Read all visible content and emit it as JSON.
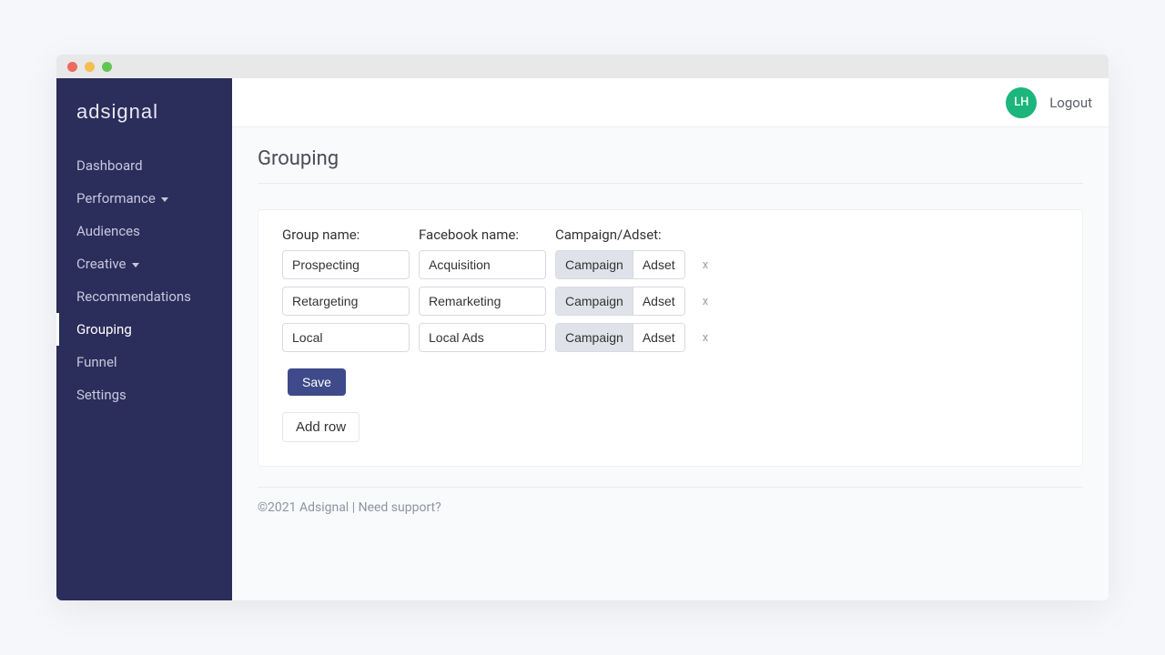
{
  "brand": "adsignal",
  "sidebar": {
    "items": [
      {
        "label": "Dashboard",
        "hasCaret": false,
        "active": false
      },
      {
        "label": "Performance",
        "hasCaret": true,
        "active": false
      },
      {
        "label": "Audiences",
        "hasCaret": false,
        "active": false
      },
      {
        "label": "Creative",
        "hasCaret": true,
        "active": false
      },
      {
        "label": "Recommendations",
        "hasCaret": false,
        "active": false
      },
      {
        "label": "Grouping",
        "hasCaret": false,
        "active": true
      },
      {
        "label": "Funnel",
        "hasCaret": false,
        "active": false
      },
      {
        "label": "Settings",
        "hasCaret": false,
        "active": false
      }
    ]
  },
  "topbar": {
    "avatar_initials": "LH",
    "logout_label": "Logout"
  },
  "page": {
    "title": "Grouping",
    "columns": {
      "group_name": "Group name:",
      "facebook_name": "Facebook name:",
      "campaign_adset": "Campaign/Adset:"
    },
    "toggle_options": {
      "campaign": "Campaign",
      "adset": "Adset"
    },
    "rows": [
      {
        "group_name": "Prospecting",
        "facebook_name": "Acquisition",
        "selected": "campaign"
      },
      {
        "group_name": "Retargeting",
        "facebook_name": "Remarketing",
        "selected": "campaign"
      },
      {
        "group_name": "Local",
        "facebook_name": "Local Ads",
        "selected": "campaign"
      }
    ],
    "row_delete_label": "x",
    "save_label": "Save",
    "add_row_label": "Add row"
  },
  "footer": {
    "copyright": "©2021 Adsignal",
    "separator": " | ",
    "support": "Need support?"
  }
}
